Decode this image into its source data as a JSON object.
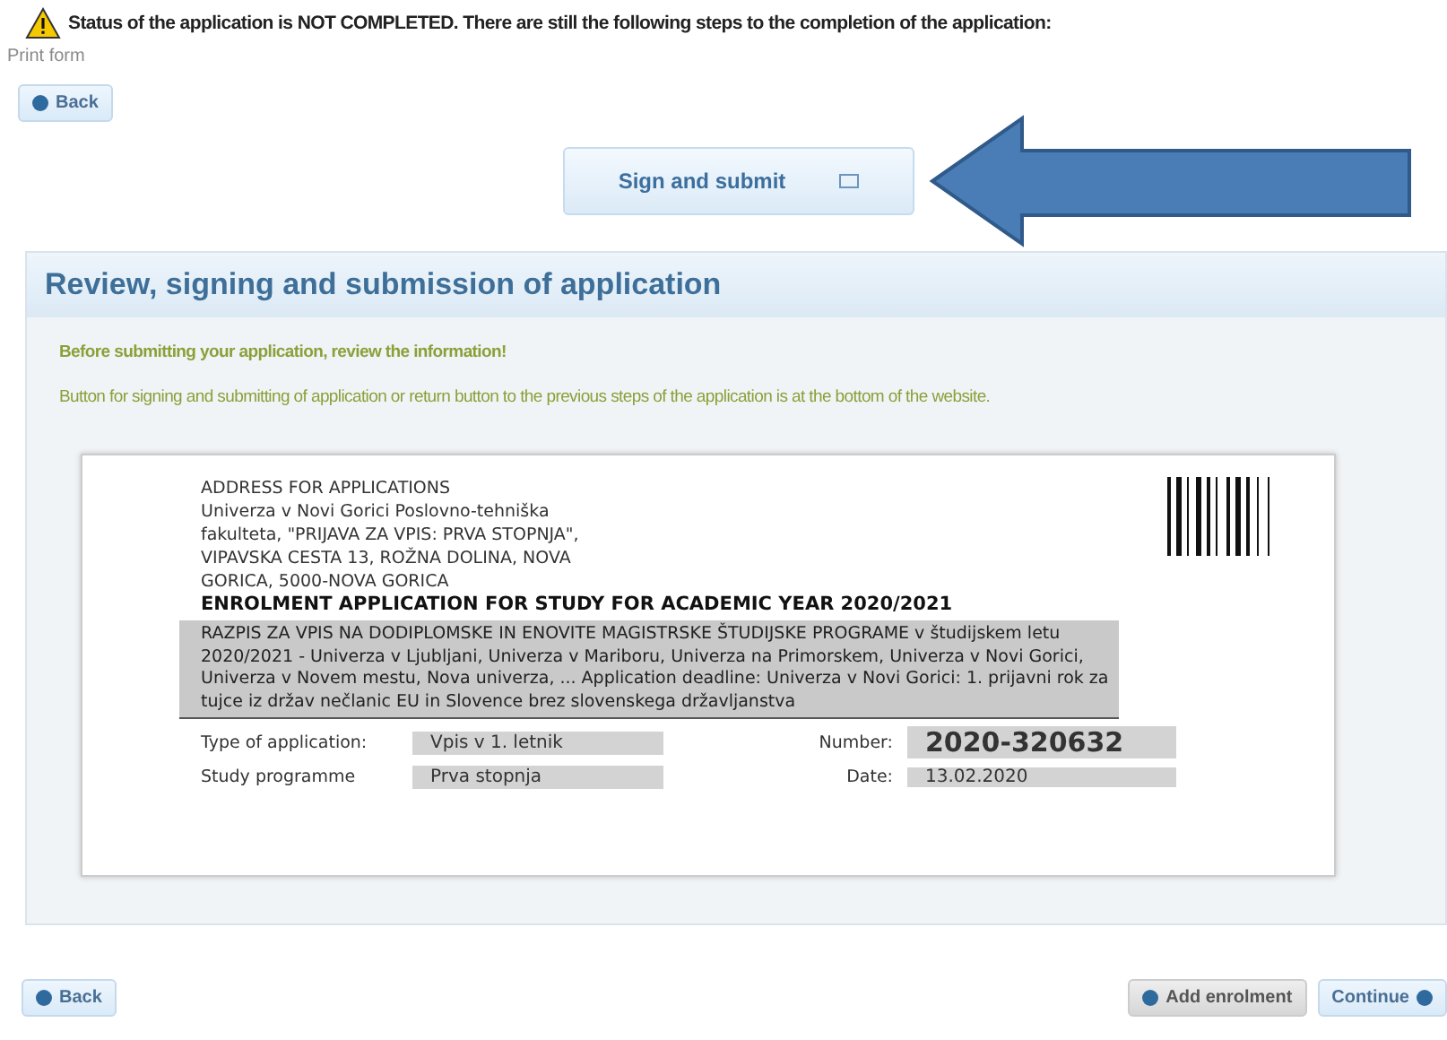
{
  "status": {
    "text": "Status of the application is NOT COMPLETED. There are still the following steps to the completion of the application:"
  },
  "print_form": "Print form",
  "top_back": "Back",
  "sign_button": "Sign and submit",
  "panel": {
    "title": "Review, signing and submission of application",
    "notes": [
      {
        "kind": "warning",
        "text": "Before submitting your application, review the information!"
      },
      {
        "kind": "info",
        "text": "Button for signing and submitting of application or return button to the previous steps of the application is at the bottom of the website."
      }
    ]
  },
  "document": {
    "address_lines": [
      "ADDRESS FOR APPLICATIONS",
      "Univerza v Novi Gorici Poslovno-tehniška",
      "fakulteta, \"PRIJAVA ZA VPIS: PRVA STOPNJA\",",
      "VIPAVSKA CESTA 13, ROŽNA DOLINA, NOVA",
      "GORICA, 5000-NOVA GORICA"
    ],
    "title": "ENROLMENT APPLICATION FOR STUDY FOR ACADEMIC YEAR 2020/2021",
    "call": "RAZPIS ZA VPIS NA DODIPLOMSKE IN ENOVITE MAGISTRSKE ŠTUDIJSKE PROGRAME v študijskem letu 2020/2021 - Univerza v Ljubljani, Univerza v Mariboru, Univerza na Primorskem, Univerza v Novi Gorici, Univerza v Novem mestu, Nova univerza, ... Application deadline: Univerza v Novi Gorici: 1. prijavni rok za tujce iz držav nečlanic EU in Slovence brez slovenskega državljanstva",
    "fields": [
      {
        "label": "Type of application:",
        "value": "Vpis v 1. letnik",
        "number_label": "Number:",
        "number": "2020-320632"
      },
      {
        "label": "Study programme",
        "value": "Prva stopnja",
        "number_label": "Date:",
        "number": "13.02.2020"
      }
    ]
  },
  "bottom": {
    "back": "Back",
    "add": "Add enrolment",
    "continue": "Continue"
  }
}
